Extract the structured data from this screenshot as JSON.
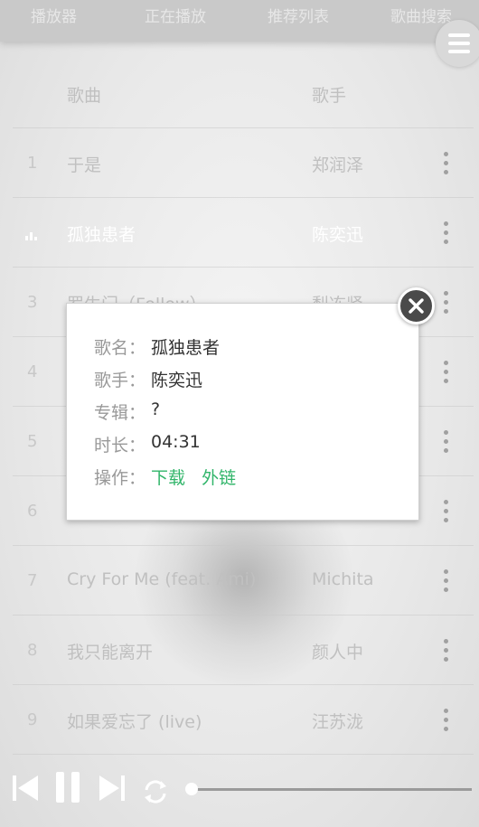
{
  "top_tabs": [
    "播放器",
    "正在播放",
    "推荐列表",
    "歌曲搜索"
  ],
  "list": {
    "header": {
      "num": "",
      "song": "歌曲",
      "artist": "歌手"
    },
    "rows": [
      {
        "num": "1",
        "song": "于是",
        "artist": "郑润泽"
      },
      {
        "num": "",
        "song": "孤独患者",
        "artist": "陈奕迅",
        "playing": true
      },
      {
        "num": "3",
        "song": "罗生门（Follow）",
        "artist": "梨冻紧"
      },
      {
        "num": "4",
        "song": "",
        "artist": ""
      },
      {
        "num": "5",
        "song": "",
        "artist": ""
      },
      {
        "num": "6",
        "song": "",
        "artist": ""
      },
      {
        "num": "7",
        "song": "Cry For Me (feat. Ami)",
        "artist": "Michita"
      },
      {
        "num": "8",
        "song": "我只能离开",
        "artist": "颜人中"
      },
      {
        "num": "9",
        "song": "如果爱忘了 (live)",
        "artist": "汪苏泷"
      }
    ]
  },
  "dialog": {
    "name_label": "歌名：",
    "name_value": "孤独患者",
    "artist_label": "歌手：",
    "artist_value": "陈奕迅",
    "album_label": "专辑：",
    "album_value": "?",
    "duration_label": "时长：",
    "duration_value": "04:31",
    "action_label": "操作：",
    "download_link": "下载",
    "external_link": "外链"
  },
  "player": {
    "progress": 0
  },
  "colors": {
    "accent_green": "#31b56a",
    "close_button": "#4a4a4a"
  },
  "icons": [
    "menu-icon",
    "more-vertical-icon",
    "equalizer-icon",
    "close-icon",
    "previous-icon",
    "pause-icon",
    "next-icon",
    "repeat-icon"
  ]
}
